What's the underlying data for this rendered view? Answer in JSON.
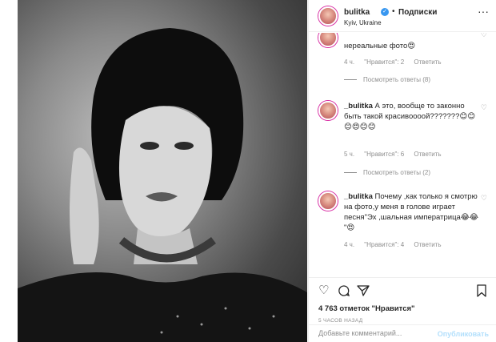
{
  "header": {
    "username": "bulitka",
    "separator": "•",
    "follow_label": "Подписки",
    "location": "Kyiv, Ukraine",
    "more_label": "···"
  },
  "comments": [
    {
      "text": "нереальные фото😍",
      "time": "4 ч.",
      "likes": "\"Нравится\": 2",
      "reply": "Ответить",
      "view_replies": "Посмотреть ответы (8)"
    },
    {
      "username": "_bulitka",
      "text": "А это, вообще то законно быть такой красивоооой???????😊😊😊😍😊😊",
      "time": "5 ч.",
      "likes": "\"Нравится\": 6",
      "reply": "Ответить",
      "view_replies": "Посмотреть ответы (2)"
    },
    {
      "username": "_bulitka",
      "text": "Почему ,как только я смотрю на фото,у меня в голове играет песня\"Эх ,шальная императрица😂😂 \"😍",
      "time": "4 ч.",
      "likes": "\"Нравится\": 4",
      "reply": "Ответить"
    }
  ],
  "actions": {
    "likes_count": "4 763 отметок \"Нравится\"",
    "time_ago": "5 ЧАСОВ НАЗАД",
    "comment_placeholder": "Добавьте комментарий...",
    "publish_label": "Опубликовать"
  },
  "icons": {
    "verified": "verified-badge-icon",
    "like": "heart-icon",
    "comment": "comment-icon",
    "share": "share-icon",
    "save": "bookmark-icon"
  },
  "colors": {
    "accent": "#3897f0",
    "muted": "#8e8e8e",
    "publish_disabled": "#b2dffc"
  }
}
